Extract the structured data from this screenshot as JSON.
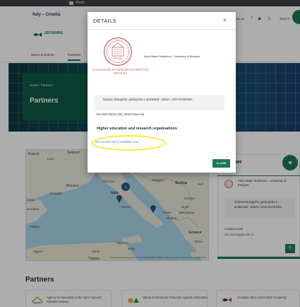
{
  "browser": {
    "tab_label": "Partn"
  },
  "header": {
    "site_title": "Italy – Croatia",
    "logo_text": "2EFISHING",
    "follow_label": "llow us",
    "search_label": "Search"
  },
  "nav": {
    "items": [
      {
        "label": "News & Events"
      },
      {
        "label": "Partners"
      }
    ]
  },
  "hero": {
    "breadcrumb": "Home / Partners",
    "title": "Partners"
  },
  "map": {
    "attribution": "Keyboard shortcuts  Map data ©2024 GeoBasis-DE/BKG (©2009), Google, Inst. Geogr. Nacional, Mapa GISrael  Terms",
    "cluster_count": "4",
    "labels": [
      {
        "text": "France"
      },
      {
        "text": "Lyon"
      },
      {
        "text": "Switzerl"
      },
      {
        "text": "Monaco"
      },
      {
        "text": "Marseille"
      },
      {
        "text": "dorra"
      },
      {
        "text": "arcelona"
      },
      {
        "text": "Palma"
      },
      {
        "text": "Algiers"
      },
      {
        "text": "Tunis"
      },
      {
        "text": "Tunisia"
      },
      {
        "text": "Florence"
      },
      {
        "text": "Italy"
      },
      {
        "text": "Rome"
      },
      {
        "text": "Sarajevo"
      },
      {
        "text": "Serbia"
      },
      {
        "text": "Sofi"
      },
      {
        "text": "Kosovo"
      },
      {
        "text": "North"
      },
      {
        "text": "Tirana"
      },
      {
        "text": "Macedonia"
      },
      {
        "text": "Albania"
      },
      {
        "text": "Greece"
      },
      {
        "text": "Palermo"
      },
      {
        "text": "Athen"
      },
      {
        "text": "Sicily"
      }
    ]
  },
  "partner_card": {
    "title": "Partner",
    "name": "Alma Mater Studiorum - University of Bologna",
    "department": "Scienze biologiche, geologiche e ambientali - BiGeA, UOS RAVENNA",
    "contact_label": "Contact email",
    "contact_email": "aris.lanzerag@unibo.it"
  },
  "partners_section": {
    "heading": "Partners",
    "cards": [
      {
        "text": "Agency for innovation in the Agri-Food and Fisheries sectors"
      },
      {
        "text": "Istituto di Servizi per il Mercato Agricolo Alimentare"
      },
      {
        "text": "Cromaris JSCo (Joint Stock Company)"
      }
    ]
  },
  "modal": {
    "title": "DETAILS",
    "close_x": "×",
    "seal_caption": "ALMA MATER STUDIORUM UNIVERSITÀ DI BOLOGNA",
    "org_name": "Alma Mater Studiorum - University of Bologna",
    "department": "Scienze biologiche, geologiche e ambientali - BiGeA, UOS RAVENNA",
    "address": "Via Sant'Alberto 163, 48123 Ravenna",
    "org_type": "Higher education and research organisations",
    "availability": "This content will be available soon",
    "close_button": "CLOSE"
  },
  "colors": {
    "accent": "#1c7a54",
    "highlight": "#f4ea2a",
    "seal": "#b4473a"
  }
}
